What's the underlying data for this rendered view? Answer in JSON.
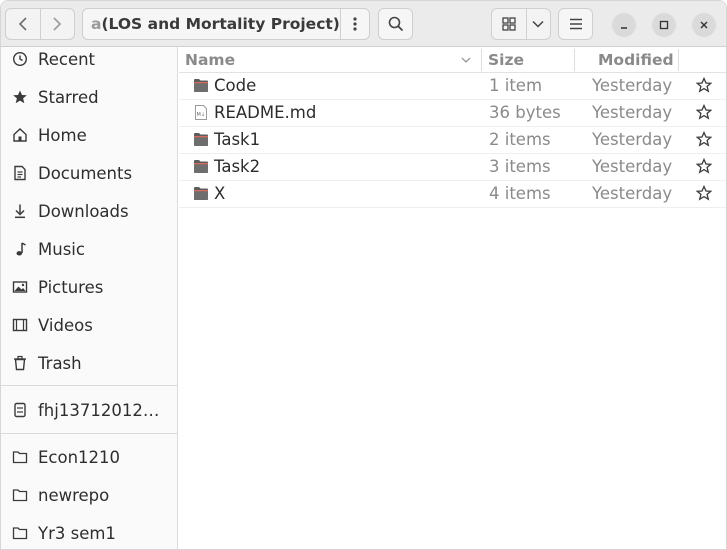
{
  "header": {
    "path_fade": "a",
    "path_label": "(LOS and Mortality Project)"
  },
  "sidebar": {
    "places": [
      {
        "label": "Recent",
        "icon": "clock-icon"
      },
      {
        "label": "Starred",
        "icon": "star-icon"
      },
      {
        "label": "Home",
        "icon": "home-icon"
      },
      {
        "label": "Documents",
        "icon": "document-icon"
      },
      {
        "label": "Downloads",
        "icon": "download-icon"
      },
      {
        "label": "Music",
        "icon": "music-icon"
      },
      {
        "label": "Pictures",
        "icon": "picture-icon"
      },
      {
        "label": "Videos",
        "icon": "video-icon"
      },
      {
        "label": "Trash",
        "icon": "trash-icon"
      }
    ],
    "devices": [
      {
        "label": "fhj13712012…",
        "icon": "network-drive-icon"
      }
    ],
    "bookmarks": [
      {
        "label": "Econ1210",
        "icon": "folder-icon"
      },
      {
        "label": "newrepo",
        "icon": "folder-icon"
      },
      {
        "label": "Yr3 sem1",
        "icon": "folder-icon"
      }
    ]
  },
  "list": {
    "columns": {
      "name": "Name",
      "size": "Size",
      "modified": "Modified"
    },
    "rows": [
      {
        "name": "Code",
        "size": "1 item",
        "modified": "Yesterday",
        "type": "folder"
      },
      {
        "name": "README.md",
        "size": "36 bytes",
        "modified": "Yesterday",
        "type": "markdown"
      },
      {
        "name": "Task1",
        "size": "2 items",
        "modified": "Yesterday",
        "type": "folder"
      },
      {
        "name": "Task2",
        "size": "3 items",
        "modified": "Yesterday",
        "type": "folder"
      },
      {
        "name": "X",
        "size": "4 items",
        "modified": "Yesterday",
        "type": "folder"
      }
    ]
  },
  "colors": {
    "folder": "#5d5d5d",
    "accent": "#303030"
  }
}
